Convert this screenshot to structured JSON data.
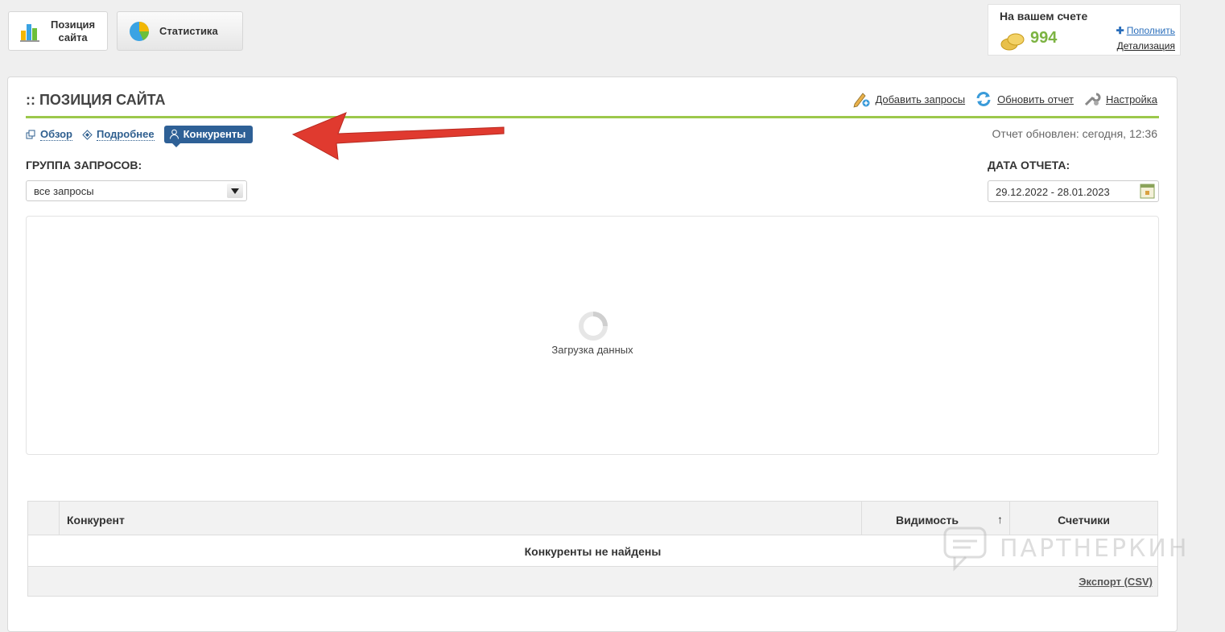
{
  "top_tabs": [
    {
      "label": "Позиция\nсайта",
      "icon": "bar-chart-icon"
    },
    {
      "label": "Статистика",
      "icon": "pie-chart-icon"
    }
  ],
  "balance": {
    "title": "На вашем счете",
    "value": "994",
    "topup": "Пополнить",
    "details": "Детализация"
  },
  "panel": {
    "title": ":: ПОЗИЦИЯ САЙТА",
    "actions": [
      {
        "label": "Добавить запросы",
        "icon": "pencil-plus-icon"
      },
      {
        "label": "Обновить отчет",
        "icon": "refresh-icon"
      },
      {
        "label": "Настройка",
        "icon": "wrench-icon"
      }
    ],
    "subtabs": [
      {
        "label": "Обзор"
      },
      {
        "label": "Подробнее"
      },
      {
        "label": "Конкуренты"
      }
    ],
    "updated": "Отчет обновлен: сегодня, 12:36"
  },
  "filters": {
    "group_label": "ГРУППА ЗАПРОСОВ:",
    "group_value": "все запросы",
    "date_label": "ДАТА ОТЧЕТА:",
    "date_value": "29.12.2022 - 28.01.2023"
  },
  "loading": {
    "text": "Загрузка данных"
  },
  "table": {
    "columns": [
      "Конкурент",
      "Видимость",
      "Счетчики"
    ],
    "sort_indicator": "↑",
    "empty": "Конкуренты не найдены",
    "export": "Экспорт (CSV)"
  },
  "watermark": "ПАРТНЕРКИН",
  "colors": {
    "accent_green": "#9cc84b",
    "active_tab": "#2e6096",
    "balance_green": "#7cb342",
    "annotation_red": "#e03a2f"
  }
}
